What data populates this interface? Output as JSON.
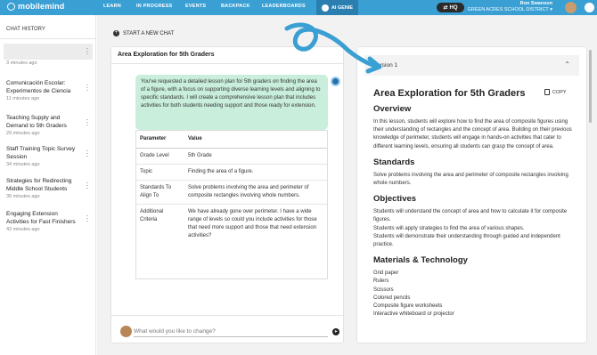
{
  "app": {
    "logo_text": "mobilemind"
  },
  "nav": {
    "items": [
      "LEARN",
      "IN PROGRESS",
      "EVENTS",
      "BACKPACK",
      "LEADERBOARDS"
    ],
    "ai_genie": "AI GENIE",
    "hq": "HQ"
  },
  "user": {
    "name": "Ron Swanson",
    "district": "GREEN ACRES SCHOOL DISTRICT"
  },
  "sidebar": {
    "title": "CHAT HISTORY",
    "items": [
      {
        "title": "",
        "time": "3 minutes ago"
      },
      {
        "title": "Comunicación Escolar: Experimentos de Ciencia",
        "time": "11 minutes ago"
      },
      {
        "title": "Teaching Supply and Demand to 5th Graders",
        "time": "29 minutes ago"
      },
      {
        "title": "Staff Training Topic Survey Session",
        "time": "34 minutes ago"
      },
      {
        "title": "Strategies for Redirecting Middle School Students",
        "time": "39 minutes ago"
      },
      {
        "title": "Engaging Extension Activities for Fast Finishers",
        "time": "43 minutes ago"
      }
    ]
  },
  "main": {
    "new_chat": "START A NEW CHAT",
    "chat": {
      "title": "Area Exploration for 5th Graders",
      "message": "You've requested a detailed lesson plan for 5th graders on finding the area of a figure, with a focus on supporting diverse learning levels and aligning to specific standards. I will create a comprehensive lesson plan that includes activities for both students needing support and those ready for extension.",
      "table": {
        "headers": [
          "Parameter",
          "Value"
        ],
        "rows": [
          {
            "param": "Grade Level",
            "value": "5th Grade"
          },
          {
            "param": "Topic",
            "value": "Finding the area of a figure."
          },
          {
            "param": "Standards To Align To",
            "value": "Solve problems involving the area and perimeter of composite rectangles involving whole numbers."
          },
          {
            "param": "Additional Criteria",
            "value": "We have already gone over perimeter. I have a wide range of levels so could you include activities for those that need more support and those that need extension activities?"
          }
        ]
      },
      "input_placeholder": "What would you like to change?"
    },
    "doc": {
      "version": "Version 1",
      "title": "Area Exploration for 5th Graders",
      "copy": "COPY",
      "overview_h": "Overview",
      "overview": "In this lesson, students will explore how to find the area of composite figures using their understanding of rectangles and the concept of area. Building on their previous knowledge of perimeter, students will engage in hands-on activities that cater to different learning levels, ensuring all students can grasp the concept of area.",
      "standards_h": "Standards",
      "standards": "Solve problems involving the area and perimeter of composite rectangles involving whole numbers.",
      "objectives_h": "Objectives",
      "objectives": [
        "Students will understand the concept of area and how to calculate it for composite figures.",
        "Students will apply strategies to find the area of various shapes.",
        "Students will demonstrate their understanding through guided and independent practice."
      ],
      "materials_h": "Materials & Technology",
      "materials": [
        "Grid paper",
        "Rulers",
        "Scissors",
        "Colored pencils",
        "Composite figure worksheets",
        "Interactive whiteboard or projector"
      ]
    }
  },
  "colors": {
    "topbar": "#3a9fd3",
    "bubble": "#c9eedc",
    "swirl": "#3a9fd3"
  },
  "icons": {
    "hq": "swap-icon",
    "new_chat": "plus-icon",
    "copy": "copy-icon",
    "send": "send-icon",
    "collapse": "chevron-up-icon"
  }
}
